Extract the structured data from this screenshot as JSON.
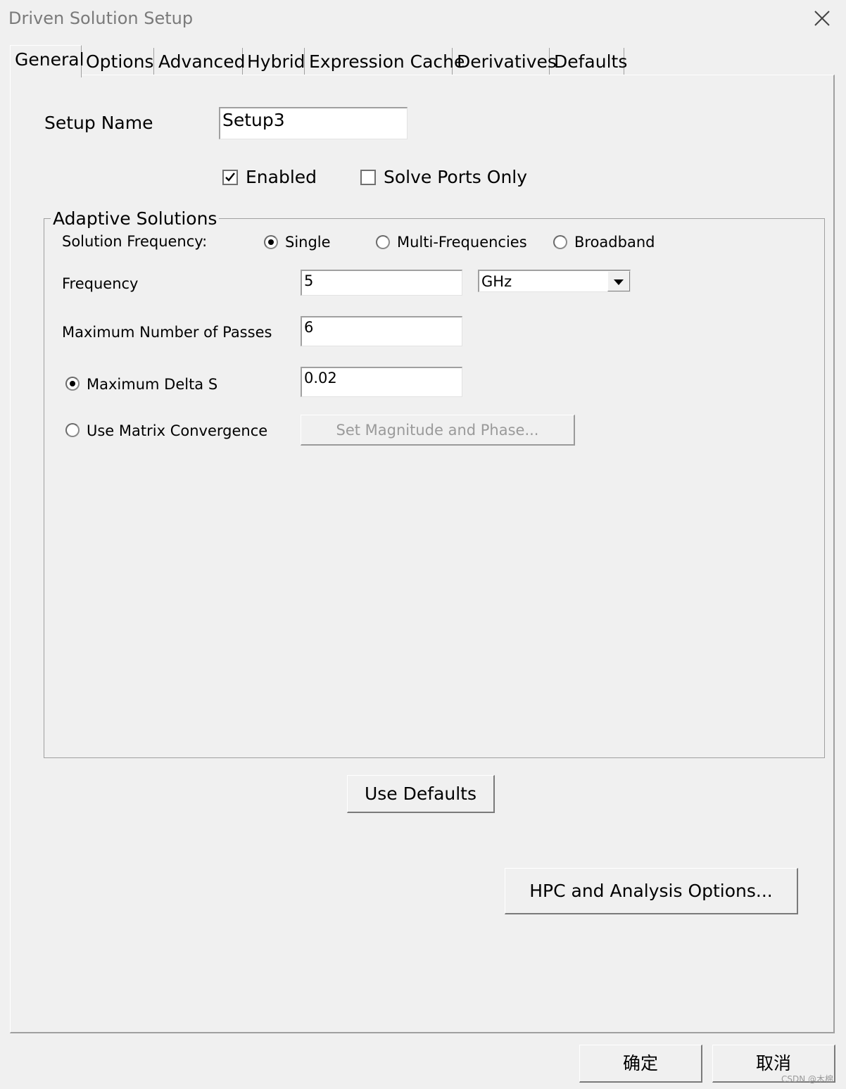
{
  "window": {
    "title": "Driven Solution Setup"
  },
  "tabs": [
    "General",
    "Options",
    "Advanced",
    "Hybrid",
    "Expression Cache",
    "Derivatives",
    "Defaults"
  ],
  "general": {
    "setup_name_label": "Setup Name",
    "setup_name_value": "Setup3",
    "enabled_label": "Enabled",
    "enabled_checked": true,
    "solve_ports_only_label": "Solve Ports Only",
    "solve_ports_only_checked": false
  },
  "adaptive": {
    "group_title": "Adaptive Solutions",
    "solution_frequency_label": "Solution Frequency:",
    "frequency_options": [
      "Single",
      "Multi-Frequencies",
      "Broadband"
    ],
    "selected_frequency_option": "Single",
    "frequency_label": "Frequency",
    "frequency_value": "5",
    "frequency_unit": "GHz",
    "max_passes_label": "Maximum Number of Passes",
    "max_passes_value": "6",
    "max_delta_s_label": "Maximum Delta S",
    "max_delta_s_value": "0.02",
    "use_matrix_label": "Use Matrix Convergence",
    "set_mag_phase_label": "Set Magnitude and Phase...",
    "selected_convergence": "Maximum Delta S"
  },
  "buttons": {
    "use_defaults": "Use Defaults",
    "hpc": "HPC and Analysis Options...",
    "ok": "确定",
    "cancel": "取消"
  },
  "watermark": "CSDN @木棉"
}
